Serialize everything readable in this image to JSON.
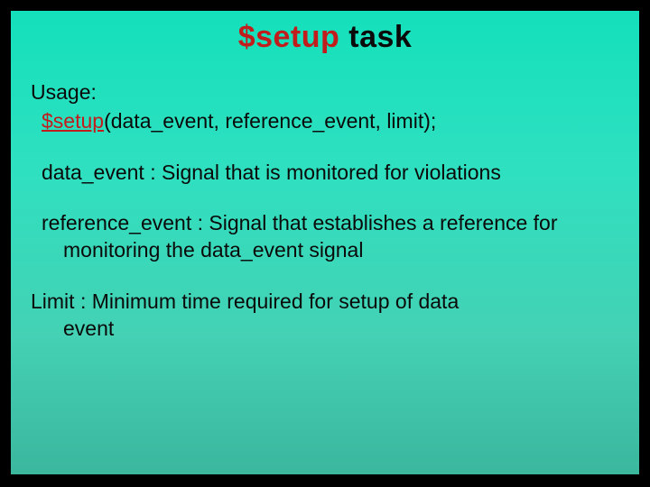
{
  "title": {
    "keyword": "$setup",
    "rest": " task"
  },
  "usage": {
    "label": "Usage:",
    "keyword": "$setup",
    "args": "(data_event, reference_event, limit);"
  },
  "params": {
    "data_event": "data_event : Signal that is monitored for violations",
    "reference_event": "reference_event : Signal that establishes a reference for monitoring the data_event signal",
    "limit_line1": "Limit  : Minimum time required for setup of data",
    "limit_line2": "event"
  }
}
